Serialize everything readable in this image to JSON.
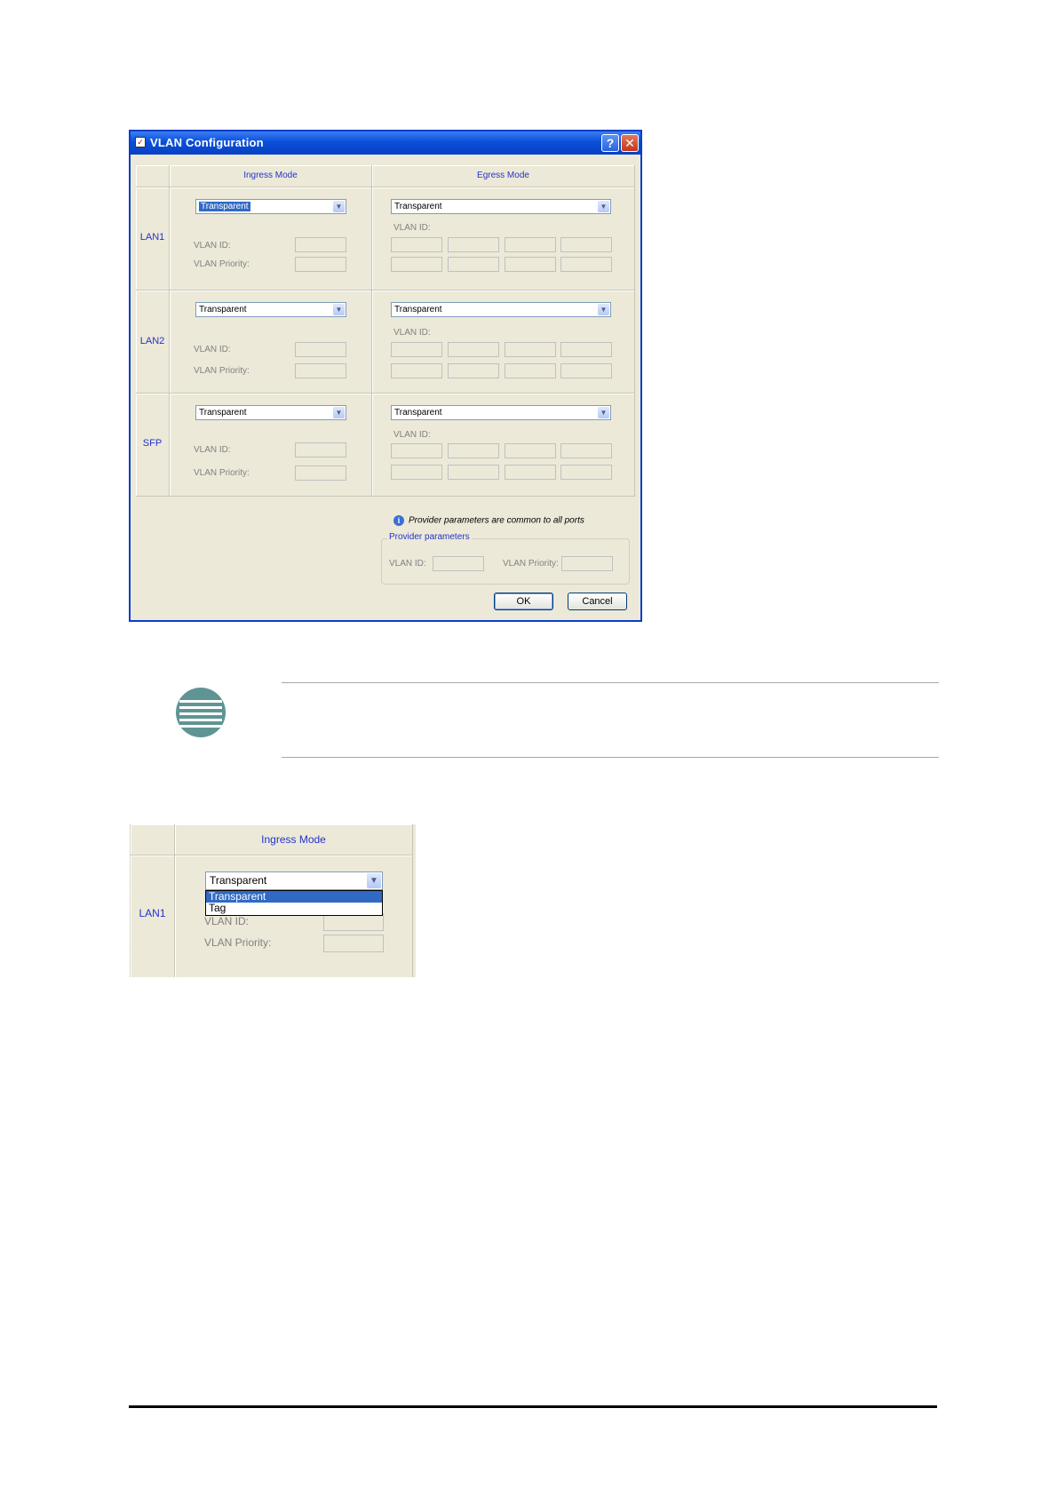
{
  "dialog": {
    "title": "VLAN Configuration",
    "help_glyph": "?",
    "close_glyph": "✕",
    "headers": {
      "ingress": "Ingress Mode",
      "egress": "Egress Mode"
    },
    "ports": [
      {
        "name": "LAN1",
        "ingress_mode": "Transparent",
        "egress_mode": "Transparent"
      },
      {
        "name": "LAN2",
        "ingress_mode": "Transparent",
        "egress_mode": "Transparent"
      },
      {
        "name": "SFP",
        "ingress_mode": "Transparent",
        "egress_mode": "Transparent"
      }
    ],
    "labels": {
      "vlan_id": "VLAN ID:",
      "vlan_priority": "VLAN Priority:"
    },
    "info_text": "Provider parameters are common to all ports",
    "provider": {
      "title": "Provider parameters",
      "vlan_id_label": "VLAN ID:",
      "vlan_priority_label": "VLAN Priority:"
    },
    "ok_label": "OK",
    "cancel_label": "Cancel"
  },
  "detail": {
    "header": "Ingress Mode",
    "port": "LAN1",
    "selected": "Transparent",
    "options": [
      "Transparent",
      "Tag"
    ],
    "vlan_id_label": "VLAN ID:",
    "vlan_priority_label": "VLAN Priority:"
  },
  "icons": {
    "dropdown": "chevron-down-icon",
    "info": "info-icon",
    "note": "note-icon"
  }
}
